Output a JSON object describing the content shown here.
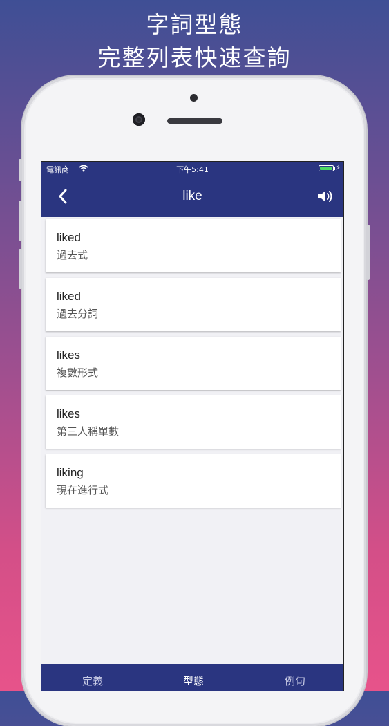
{
  "promo": {
    "line1": "字詞型態",
    "line2": "完整列表快速查詢"
  },
  "status_bar": {
    "carrier": "電訊商",
    "time": "下午5:41"
  },
  "nav": {
    "title": "like",
    "back_icon": "chevron-left-icon",
    "speaker_icon": "speaker-icon"
  },
  "forms": [
    {
      "word": "liked",
      "label": "過去式"
    },
    {
      "word": "liked",
      "label": "過去分詞"
    },
    {
      "word": "likes",
      "label": "複數形式"
    },
    {
      "word": "likes",
      "label": "第三人稱單數"
    },
    {
      "word": "liking",
      "label": "現在進行式"
    }
  ],
  "tabs": [
    {
      "label": "定義",
      "active": false
    },
    {
      "label": "型態",
      "active": true
    },
    {
      "label": "例句",
      "active": false
    }
  ],
  "colors": {
    "nav_bg": "#2a3580",
    "battery": "#4cd964"
  }
}
